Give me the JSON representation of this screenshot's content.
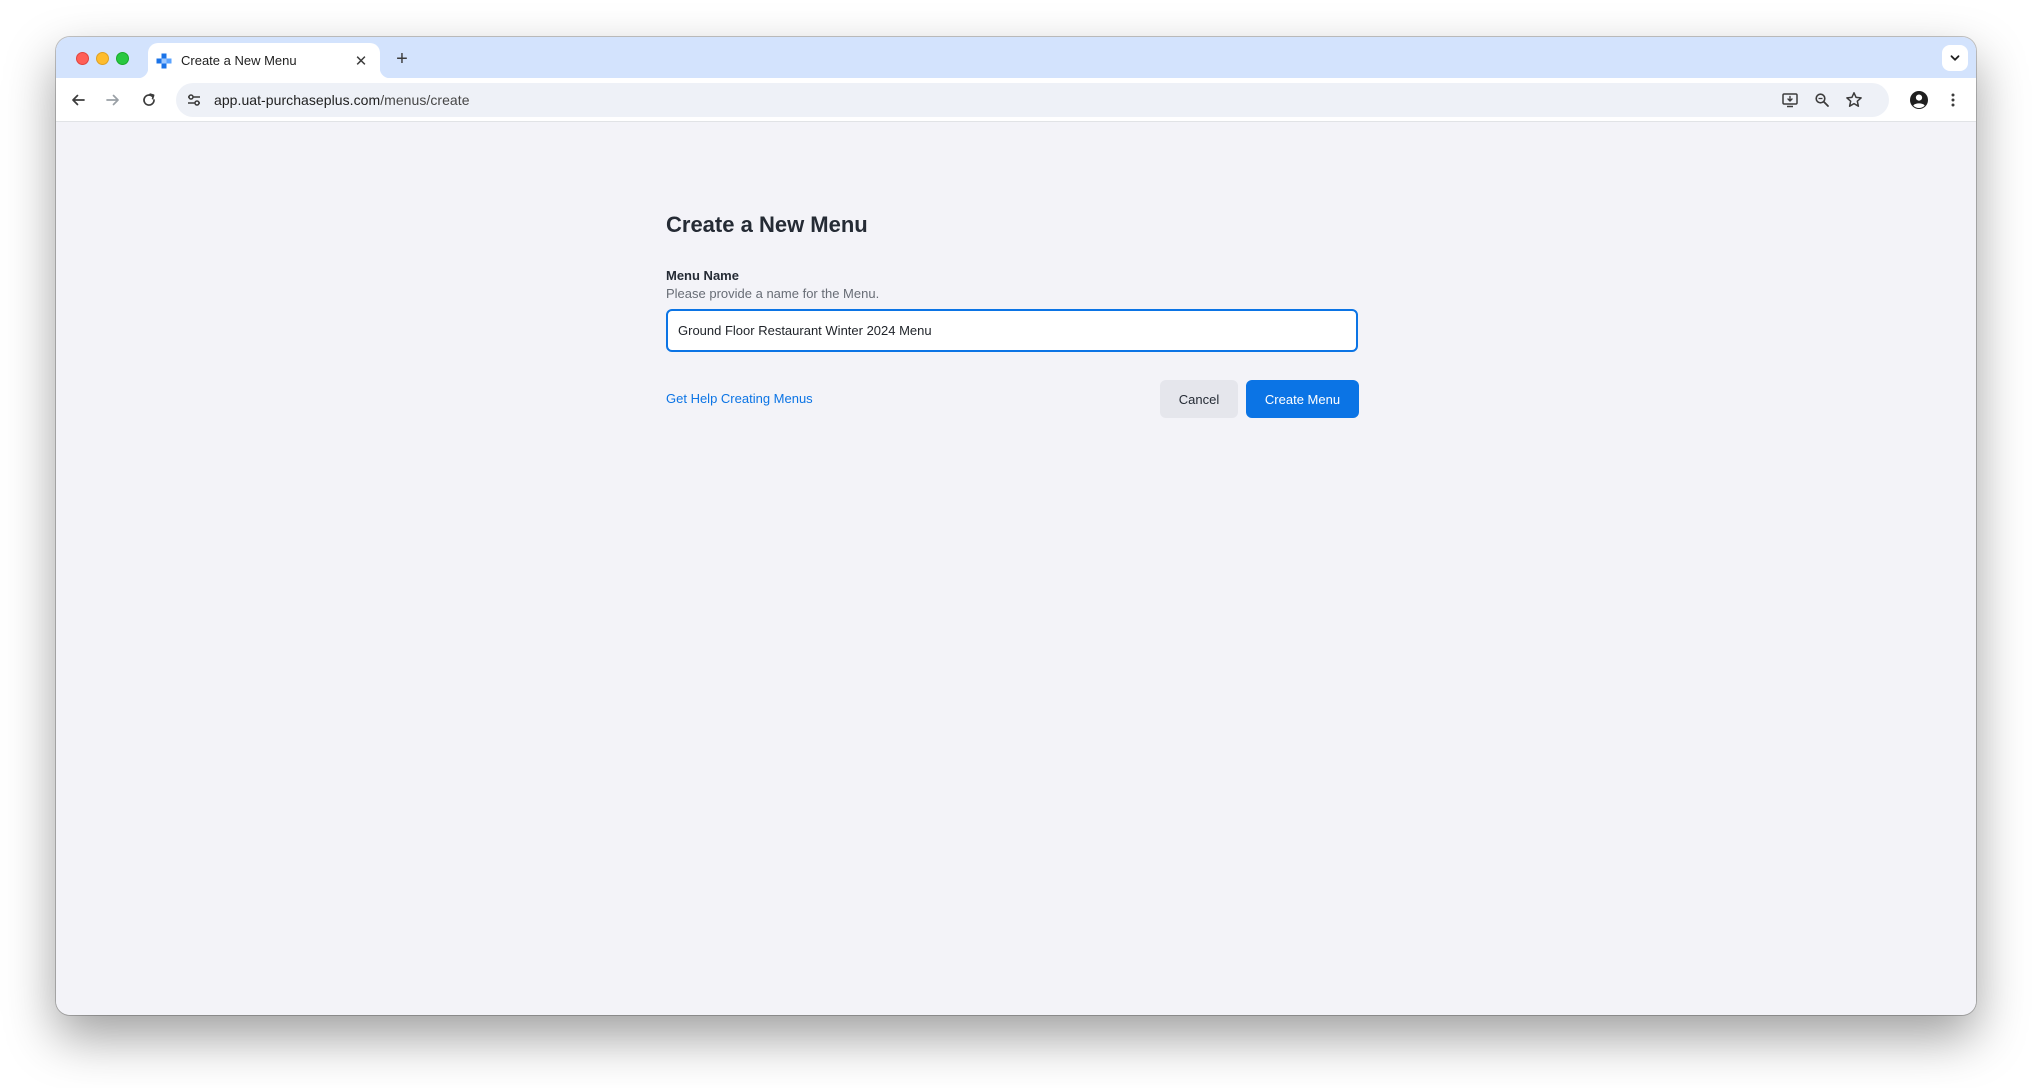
{
  "browser": {
    "tab_title": "Create a New Menu",
    "tab_close_glyph": "✕",
    "new_tab_glyph": "+",
    "url_host": "app.uat-purchaseplus.com",
    "url_path": "/menus/create"
  },
  "page": {
    "title": "Create a New Menu",
    "menu_name_label": "Menu Name",
    "menu_name_help": "Please provide a name for the Menu.",
    "menu_name_value": "Ground Floor Restaurant Winter 2024 Menu",
    "help_link": "Get Help Creating Menus",
    "cancel_label": "Cancel",
    "create_label": "Create Menu"
  },
  "colors": {
    "accent": "#0b74e5",
    "tab_strip": "#d3e3fd",
    "page_background": "#f3f3f8"
  },
  "icons": [
    "favicon",
    "back-arrow-icon",
    "forward-arrow-icon",
    "reload-icon",
    "site-info-icon",
    "install-app-icon",
    "zoom-icon",
    "bookmark-star-icon",
    "profile-icon",
    "menu-kebab-icon",
    "tab-search-chevron-icon"
  ]
}
